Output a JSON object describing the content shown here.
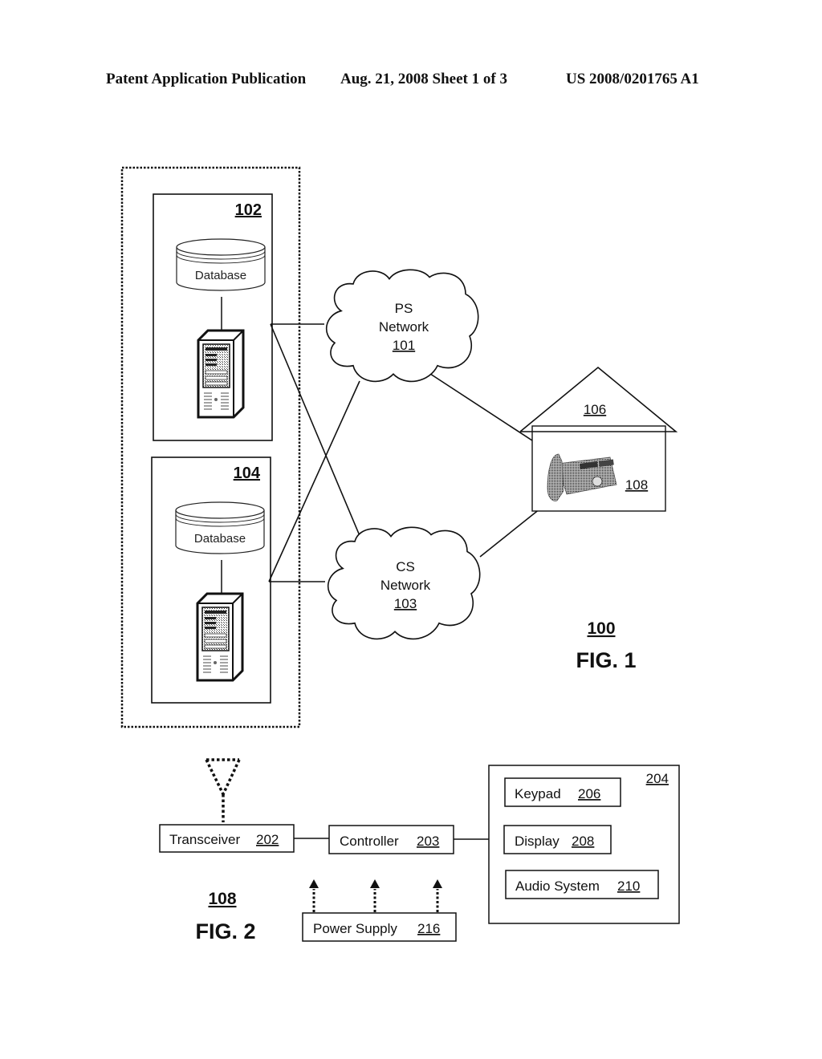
{
  "header": {
    "publication": "Patent Application Publication",
    "date_sheet": "Aug. 21, 2008  Sheet 1 of 3",
    "number": "US 2008/0201765 A1"
  },
  "fig1": {
    "ref": "100",
    "caption": "FIG. 1",
    "server_blocks": [
      {
        "ref": "102",
        "database_label": "Database"
      },
      {
        "ref": "104",
        "database_label": "Database"
      }
    ],
    "networks": [
      {
        "line1": "PS",
        "line2": "Network",
        "ref": "101"
      },
      {
        "line1": "CS",
        "line2": "Network",
        "ref": "103"
      }
    ],
    "premises_ref": "106",
    "phone_ref": "108"
  },
  "fig2": {
    "ref": "108",
    "caption": "FIG. 2",
    "transceiver": {
      "label": "Transceiver",
      "ref": "202"
    },
    "controller": {
      "label": "Controller",
      "ref": "203"
    },
    "power_supply": {
      "label": "Power Supply",
      "ref": "216"
    },
    "ui_group_ref": "204",
    "ui_items": [
      {
        "label": "Keypad",
        "ref": "206"
      },
      {
        "label": "Display",
        "ref": "208"
      },
      {
        "label": "Audio System",
        "ref": "210"
      }
    ]
  }
}
